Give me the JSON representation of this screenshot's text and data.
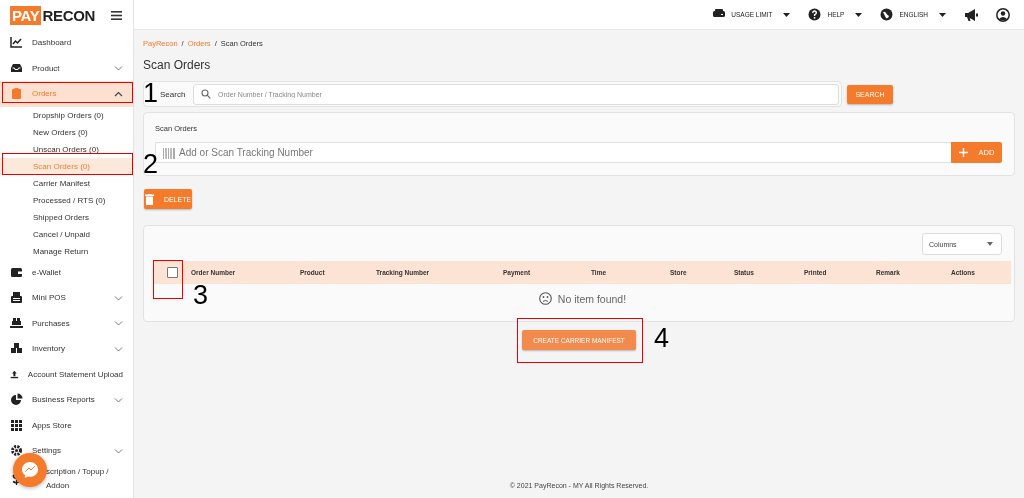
{
  "sidebar": {
    "logo": {
      "part_1": "PAY",
      "part_2": "RECON"
    },
    "items": [
      {
        "label": "Dashboard",
        "selected": false
      },
      {
        "label": "Product",
        "selected": false,
        "expanded": false
      },
      {
        "label": "Orders",
        "selected": true,
        "expanded": true,
        "children": [
          {
            "label": "Dropship Orders (0)",
            "selected": false
          },
          {
            "label": "New Orders (0)",
            "selected": false
          },
          {
            "label": "Unscan Orders (0)",
            "selected": false
          },
          {
            "label": "Scan Orders (0)",
            "selected": true
          },
          {
            "label": "Carrier Manifest",
            "selected": false
          },
          {
            "label": "Processed / RTS (0)",
            "selected": false
          },
          {
            "label": "Shipped Orders",
            "selected": false
          },
          {
            "label": "Cancel / Unpaid",
            "selected": false
          },
          {
            "label": "Manage Return",
            "selected": false
          }
        ]
      },
      {
        "label": "e-Wallet",
        "selected": false
      },
      {
        "label": "Mini POS",
        "selected": false,
        "expanded": false
      },
      {
        "label": "Purchases",
        "selected": false,
        "expanded": false
      },
      {
        "label": "Inventory",
        "selected": false,
        "expanded": false
      },
      {
        "label": "Account Statement Upload",
        "selected": false
      },
      {
        "label": "Business Reports",
        "selected": false,
        "expanded": false
      },
      {
        "label": "Apps Store",
        "selected": false
      },
      {
        "label": "Settings",
        "selected": false,
        "expanded": false
      },
      {
        "label": "scription / Topup / Addon",
        "selected": false
      }
    ]
  },
  "topbar": {
    "items": [
      {
        "label": "USAGE LIMIT"
      },
      {
        "label": "HELP"
      },
      {
        "label": "ENGLISH"
      }
    ]
  },
  "breadcrumb": [
    {
      "label": "PayRecon",
      "kind": "link"
    },
    {
      "label": "/",
      "kind": "separator"
    },
    {
      "label": "Orders",
      "kind": "link"
    },
    {
      "label": "/",
      "kind": "separator"
    },
    {
      "label": "Scan Orders",
      "kind": "current"
    }
  ],
  "page_title": "Scan Orders",
  "search": {
    "label": "Search",
    "placeholder": "Order Number / Tracking Number",
    "button": "SEARCH"
  },
  "scan": {
    "title": "Scan Orders",
    "placeholder": "Add or Scan Tracking Number",
    "button": "ADD"
  },
  "delete_button": "DELETE",
  "table": {
    "columns_select": "Columns",
    "header_checkbox": {
      "checked": false
    },
    "columns": [
      "Order Number",
      "Product",
      "Tracking Number",
      "Payment",
      "Time",
      "Store",
      "Status",
      "Printed",
      "Remark",
      "Actions"
    ],
    "empty_message": "No item found!"
  },
  "manifest_button": "CREATE CARRIER MANIFEST",
  "footer": "© 2021 PayRecon - MY All Rights Reserved.",
  "annotations": [
    {
      "number": "1"
    },
    {
      "number": "2"
    },
    {
      "number": "3"
    },
    {
      "number": "4"
    }
  ]
}
